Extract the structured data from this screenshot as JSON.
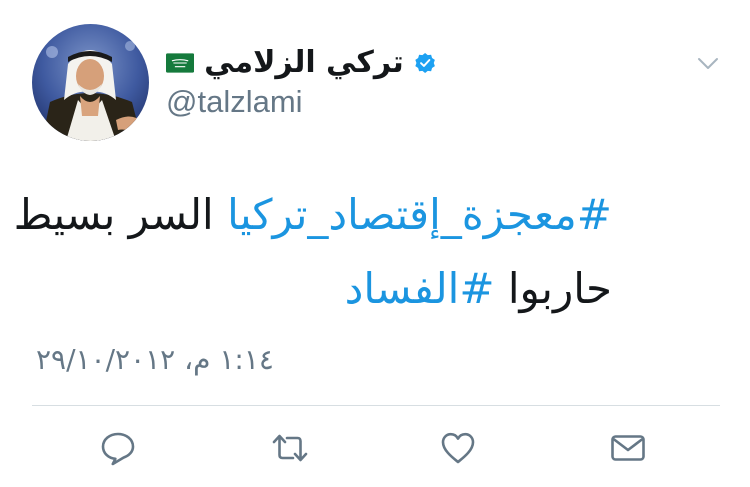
{
  "user": {
    "display_name": "تركي الزلامي",
    "handle": "@talzlami",
    "verified": true,
    "flag": "saudi-arabia-flag"
  },
  "tweet": {
    "hashtag1": "#معجزة_إقتصاد_تركيا",
    "text1": "السر بسيط",
    "text2": "حاربوا",
    "hashtag2": "#الفساد",
    "timestamp": "١:١٤ م، ٢٩/١٠/٢٠١٢"
  },
  "actions": {
    "reply": "reply-icon",
    "retweet": "retweet-icon",
    "like": "heart-icon",
    "message": "envelope-icon"
  },
  "colors": {
    "link": "#1b95e0",
    "text": "#14171a",
    "secondary": "#657786",
    "verified": "#1da1f2"
  }
}
